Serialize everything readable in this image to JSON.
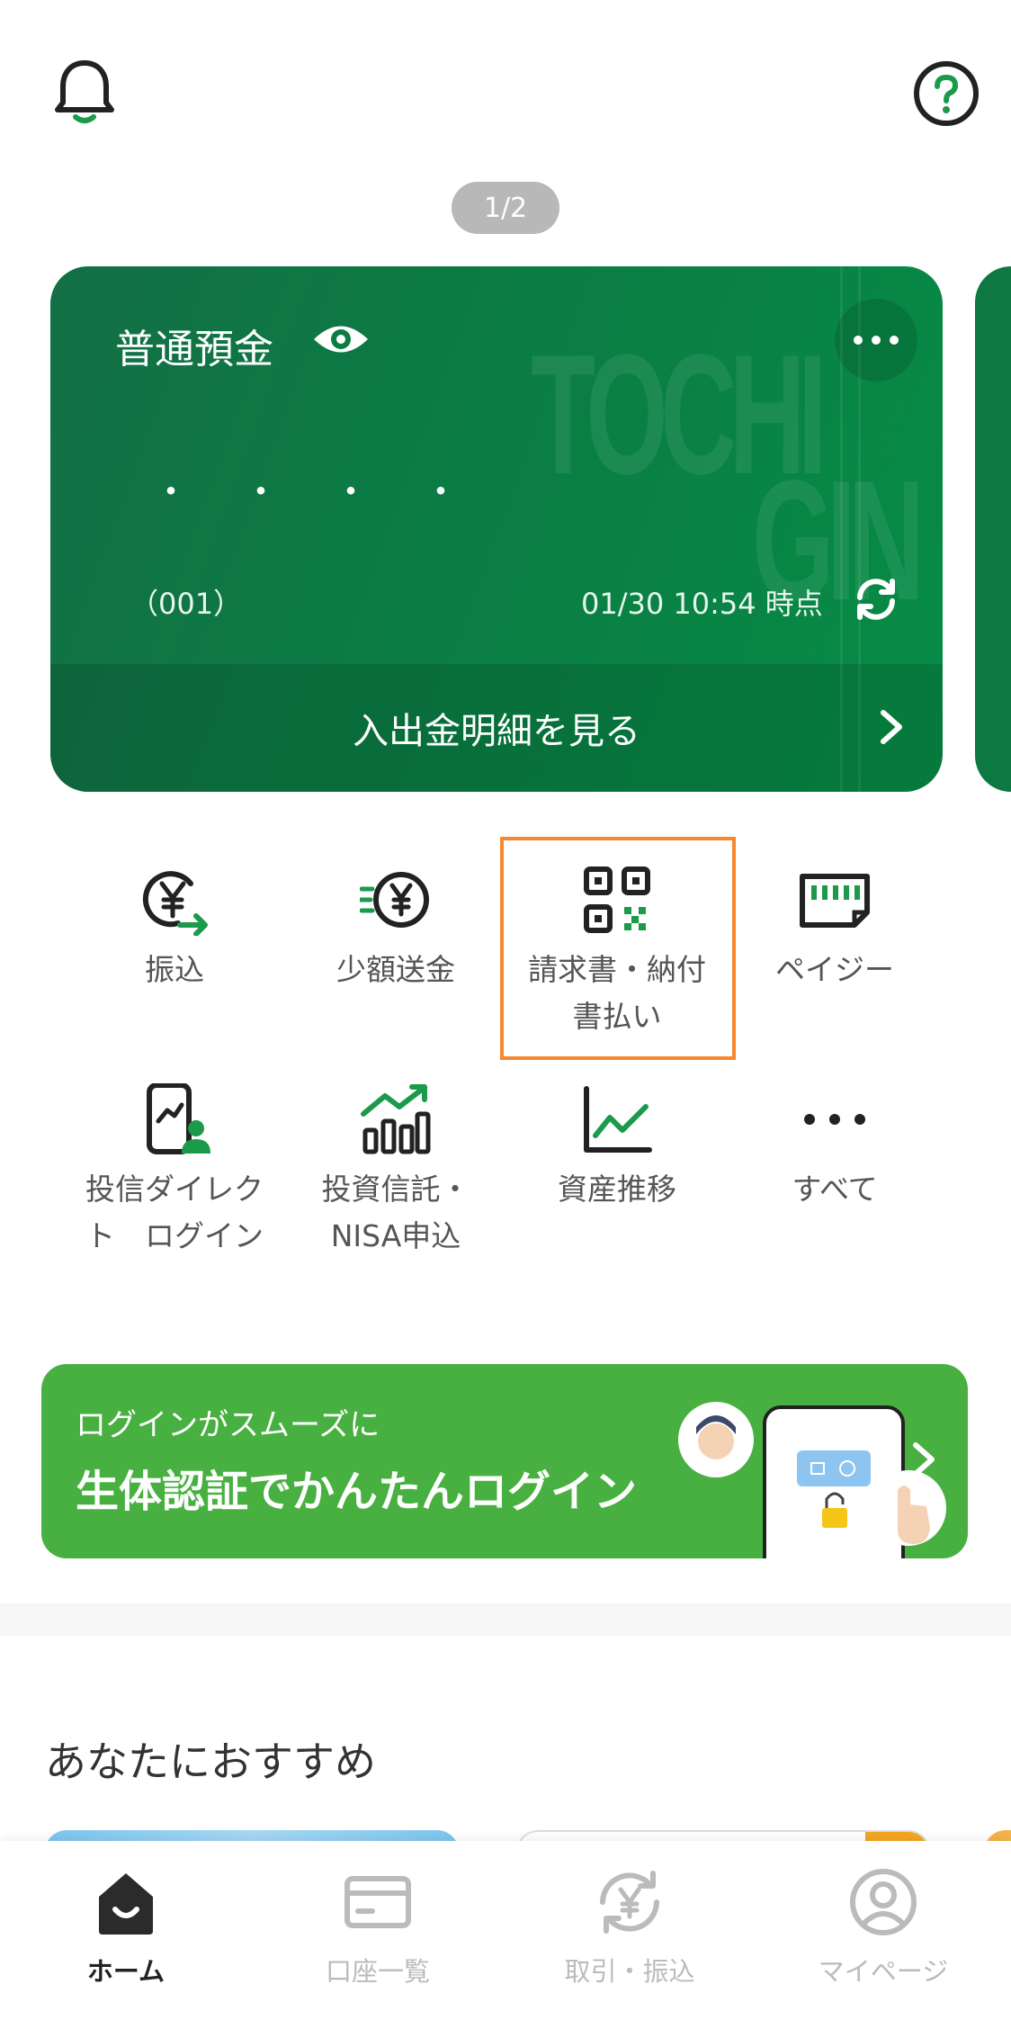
{
  "header": {
    "pager": "1/2"
  },
  "account_card": {
    "type": "普通預金",
    "balance_masked": "・・・・",
    "branch": "（001）",
    "timestamp": "01/30 10:54 時点",
    "watermark_top": "TOCHI",
    "watermark_bottom": "GIN",
    "details_link": "入出金明細を見る"
  },
  "menu": [
    {
      "label": "振込",
      "icon": "yen-transfer-icon"
    },
    {
      "label": "少額送金",
      "icon": "yen-fast-icon"
    },
    {
      "label": "請求書・納付\n書払い",
      "icon": "qr-code-icon"
    },
    {
      "label": "ペイジー",
      "icon": "payeasy-icon"
    },
    {
      "label": "投信ダイレク\nト　ログイン",
      "icon": "phone-chart-user-icon"
    },
    {
      "label": "投資信託・\nNISA申込",
      "icon": "bar-chart-up-icon"
    },
    {
      "label": "資産推移",
      "icon": "line-chart-icon"
    },
    {
      "label": "すべて",
      "icon": "more-dots-icon"
    }
  ],
  "banner": {
    "sub": "ログインがスムーズに",
    "main": "生体認証でかんたんログイン"
  },
  "recommend": {
    "title": "あなたにおすすめ"
  },
  "tabbar": [
    {
      "label": "ホーム",
      "active": true
    },
    {
      "label": "口座一覧",
      "active": false
    },
    {
      "label": "取引・振込",
      "active": false
    },
    {
      "label": "マイページ",
      "active": false
    }
  ],
  "colors": {
    "brand_green": "#0b7c44",
    "banner_green": "#48b040",
    "highlight_orange": "#f7882f",
    "icon_green": "#1a9a4a"
  }
}
